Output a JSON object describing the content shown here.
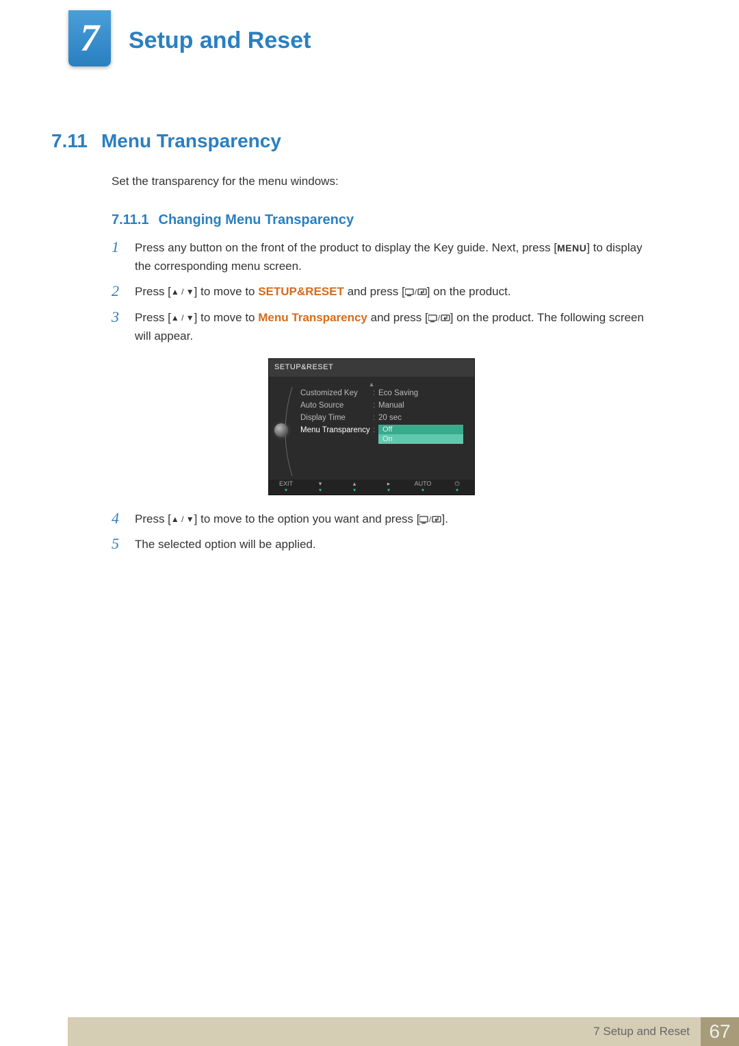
{
  "chapter": {
    "number": "7",
    "title": "Setup and Reset"
  },
  "section": {
    "number": "7.11",
    "title": "Menu Transparency",
    "intro": "Set the transparency for the menu windows:"
  },
  "subsection": {
    "number": "7.11.1",
    "title": "Changing Menu Transparency"
  },
  "steps": {
    "s1": {
      "num": "1",
      "a": "Press any button on the front of the product to display the Key guide. Next, press [",
      "menu": "MENU",
      "b": "] to display the corresponding menu screen."
    },
    "s2": {
      "num": "2",
      "a": "Press [",
      "b": "] to move to ",
      "kw": "SETUP&RESET",
      "c": " and press [",
      "d": "] on the product."
    },
    "s3": {
      "num": "3",
      "a": "Press [",
      "b": "] to move to ",
      "kw": "Menu Transparency",
      "c": " and press [",
      "d": "] on the product. The following screen will appear."
    },
    "s4": {
      "num": "4",
      "a": "Press [",
      "b": "] to move to the option you want and press [",
      "c": "]."
    },
    "s5": {
      "num": "5",
      "text": "The selected option will be applied."
    }
  },
  "osd": {
    "title": "SETUP&RESET",
    "rows": [
      {
        "label": "Customized Key",
        "value": "Eco Saving"
      },
      {
        "label": "Auto Source",
        "value": "Manual"
      },
      {
        "label": "Display Time",
        "value": "20 sec"
      },
      {
        "label": "Menu Transparency",
        "value": ""
      }
    ],
    "options": {
      "off": "Off",
      "on": "On"
    },
    "footer": {
      "exit": "EXIT",
      "auto": "AUTO"
    }
  },
  "footer": {
    "text": "7 Setup and Reset",
    "page": "67"
  }
}
